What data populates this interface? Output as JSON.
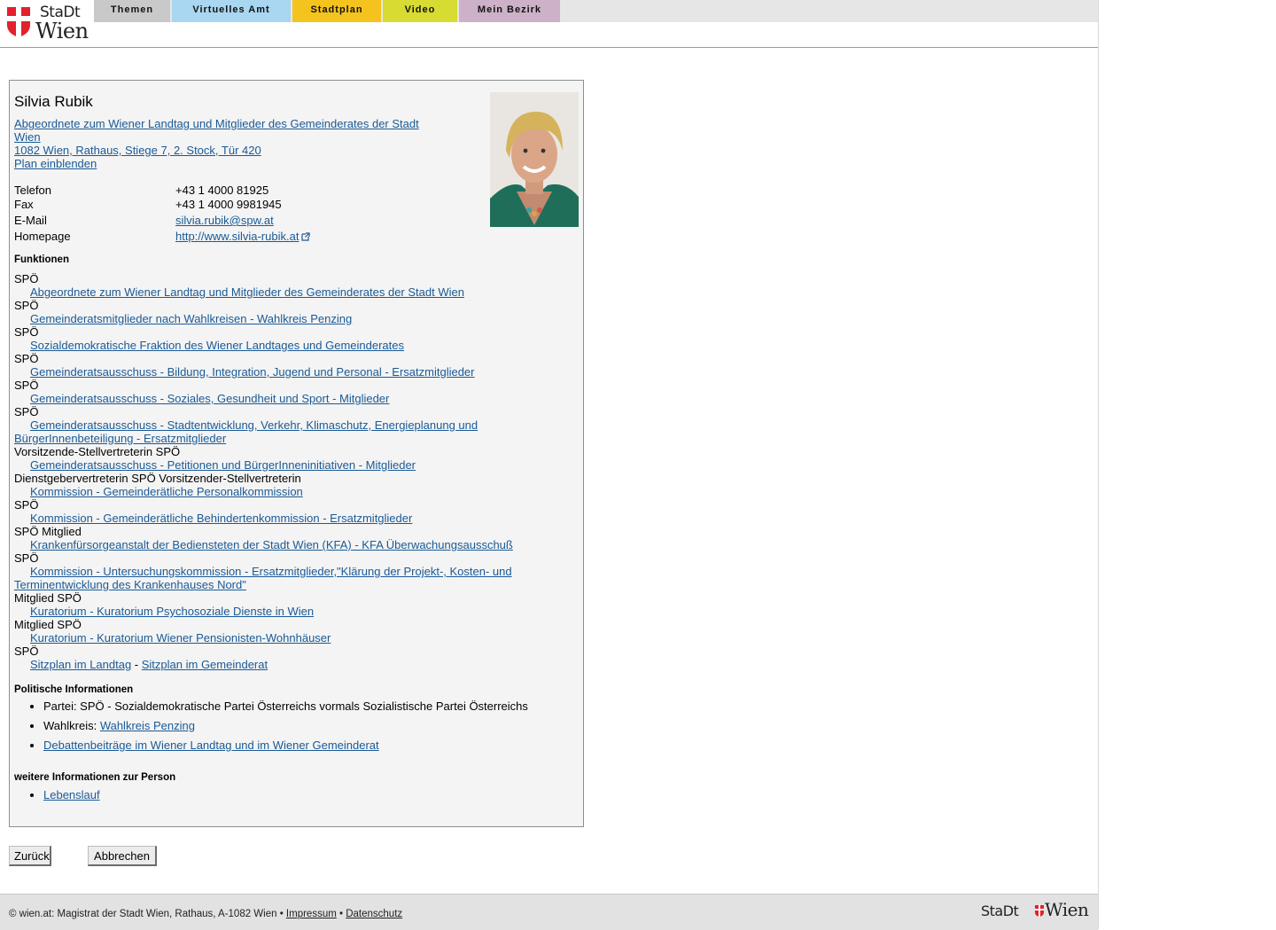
{
  "logo": {
    "line1": "StaDt",
    "line2": "Wien"
  },
  "nav": {
    "tabs": [
      "Themen",
      "Virtuelles Amt",
      "Stadtplan",
      "Video",
      "Mein Bezirk"
    ]
  },
  "person": {
    "name": "Silvia Rubik",
    "position_line1": "Abgeordnete zum Wiener Landtag und Mitglieder des Gemeinderates der Stadt",
    "position_line2": "Wien ",
    "address": "1082 Wien, Rathaus, Stiege 7, 2. Stock, Tür 420",
    "map_link": "Plan einblenden",
    "phone_label": "Telefon",
    "phone": "+43 1 4000 81925",
    "fax_label": "Fax",
    "fax": "+43 1 4000 9981945",
    "email_label": "E-Mail",
    "email": "silvia.rubik@spw.at",
    "homepage_label": "Homepage",
    "homepage": "http://www.silvia-rubik.at"
  },
  "functions": {
    "heading": "Funktionen",
    "items": [
      {
        "role": "SPÖ",
        "link": "Abgeordnete zum Wiener Landtag und Mitglieder des Gemeinderates der Stadt Wien"
      },
      {
        "role": "SPÖ",
        "link": "Gemeinderatsmitglieder nach Wahlkreisen - Wahlkreis Penzing"
      },
      {
        "role": "SPÖ",
        "link": "Sozialdemokratische Fraktion des Wiener Landtages und Gemeinderates"
      },
      {
        "role": "SPÖ",
        "link": "Gemeinderatsausschuss - Bildung, Integration, Jugend und Personal - Ersatzmitglieder"
      },
      {
        "role": "SPÖ",
        "link": "Gemeinderatsausschuss - Soziales, Gesundheit und Sport - Mitglieder"
      },
      {
        "role": "SPÖ",
        "link": "Gemeinderatsausschuss - Stadtentwicklung, Verkehr, Klimaschutz, Energieplanung und BürgerInnenbeteiligung - Ersatzmitglieder"
      },
      {
        "role": "Vorsitzende-Stellvertreterin SPÖ",
        "link": "Gemeinderatsausschuss - Petitionen und BürgerInneninitiativen - Mitglieder"
      },
      {
        "role": "Dienstgebervertreterin SPÖ Vorsitzender-Stellvertreterin",
        "link": "Kommission - Gemeinderätliche Personalkommission"
      },
      {
        "role": "SPÖ",
        "link": "Kommission - Gemeinderätliche Behindertenkommission - Ersatzmitglieder"
      },
      {
        "role": "SPÖ Mitglied",
        "link": "Krankenfürsorgeanstalt der Bediensteten der Stadt Wien (KFA) - KFA Überwachungsausschuß"
      },
      {
        "role": "SPÖ",
        "link": "Kommission - Untersuchungskommission - Ersatzmitglieder,\"Klärung der Projekt-, Kosten- und Terminentwicklung des Krankenhauses Nord\""
      },
      {
        "role": "Mitglied SPÖ",
        "link": "Kuratorium - Kuratorium Psychosoziale Dienste in Wien"
      },
      {
        "role": "Mitglied SPÖ",
        "link": "Kuratorium - Kuratorium Wiener Pensionisten-Wohnhäuser"
      },
      {
        "role": "SPÖ",
        "link": ""
      }
    ],
    "seat_landtag": "Sitzplan im Landtag",
    "seat_sep": " - ",
    "seat_gemeinderat": "Sitzplan im Gemeinderat"
  },
  "politics": {
    "heading": "Politische Informationen",
    "party": "Partei: SPÖ - Sozialdemokratische Partei Österreichs vormals Sozialistische Partei Österreichs",
    "district_label": "Wahlkreis: ",
    "district_link": "Wahlkreis Penzing",
    "debates_link": "Debattenbeiträge im Wiener Landtag und im Wiener Gemeinderat"
  },
  "more": {
    "heading": "weitere Informationen zur Person",
    "cv_link": "Lebenslauf"
  },
  "buttons": {
    "back": "Zurück",
    "cancel": "Abbrechen"
  },
  "footer": {
    "text": "© wien.at: Magistrat der Stadt Wien, Rathaus, A-1082 Wien • ",
    "impressum": "Impressum",
    "sep": " • ",
    "privacy": "Datenschutz",
    "logo_a": "StaDt",
    "logo_b": "Wien"
  }
}
